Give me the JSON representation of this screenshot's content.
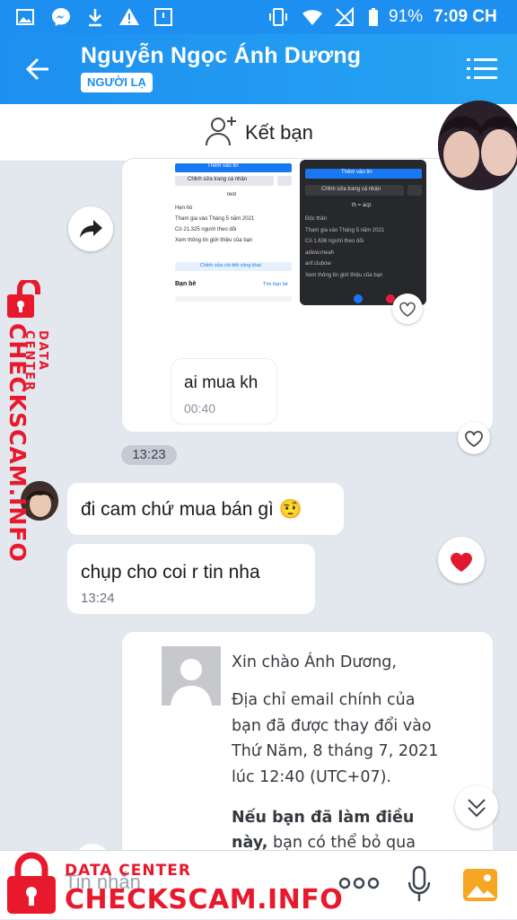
{
  "status_bar": {
    "battery": "91%",
    "time": "7:09 CH"
  },
  "header": {
    "contact_name": "Nguyễn Ngọc Ánh Dương",
    "stranger_badge": "NGƯỜI LẠ"
  },
  "add_friend": {
    "label": "Kết bạn"
  },
  "messages": {
    "m1_text": "ai mua kh",
    "m1_time": "00:40",
    "time_separator": "13:23",
    "m2_text": "đi cam chứ mua bán gì 🤨",
    "m3_text": "chụp cho coi r tin nha",
    "m3_time": "13:24"
  },
  "screenshot_left": {
    "btn1": "Thêm vào tin",
    "btn2": "Chỉnh sửa trang cá nhân",
    "name": "rest",
    "l1": "Hẹn hò",
    "l2": "Tham gia vào Tháng 5 năm 2021",
    "l3": "Có 21.325 người theo dõi",
    "l4": "Xem thông tin giới thiệu của bạn",
    "l5": "Chỉnh sửa chi tiết công khai",
    "friends": "Bạn bè",
    "find": "Tìm bạn bè"
  },
  "screenshot_right": {
    "btn1": "Thêm vào tin",
    "btn2": "Chỉnh sửa trang cá nhân",
    "name": "th = acp",
    "l1": "Độc thân",
    "l2": "Tham gia vào Tháng 5 năm 2021",
    "l3": "Có 1.636 người theo dõi",
    "l4": "adiow.meah",
    "l5": "anf.clubow",
    "l6": "Xem thông tin giới thiệu của bạn"
  },
  "email": {
    "greeting": "Xin chào Ánh Dương,",
    "line1": "Địa chỉ email chính của",
    "line2": "bạn đã được thay đổi vào",
    "line3": "Thứ Năm, 8 tháng 7, 2021",
    "line4": "lúc 12:40 (UTC+07).",
    "bold1": "Nếu bạn đã làm điều",
    "bold2": "này,",
    "rest2": " bạn có thể bỏ qua"
  },
  "input": {
    "placeholder": "Tin nhắn"
  },
  "watermark": {
    "data_center": "DATA CENTER",
    "site": "CHECKSCAM.INFO"
  },
  "colors": {
    "zalo_blue": "#1d8ff0",
    "watermark_red": "#e8192c",
    "chat_bg": "#e3e8ef"
  }
}
